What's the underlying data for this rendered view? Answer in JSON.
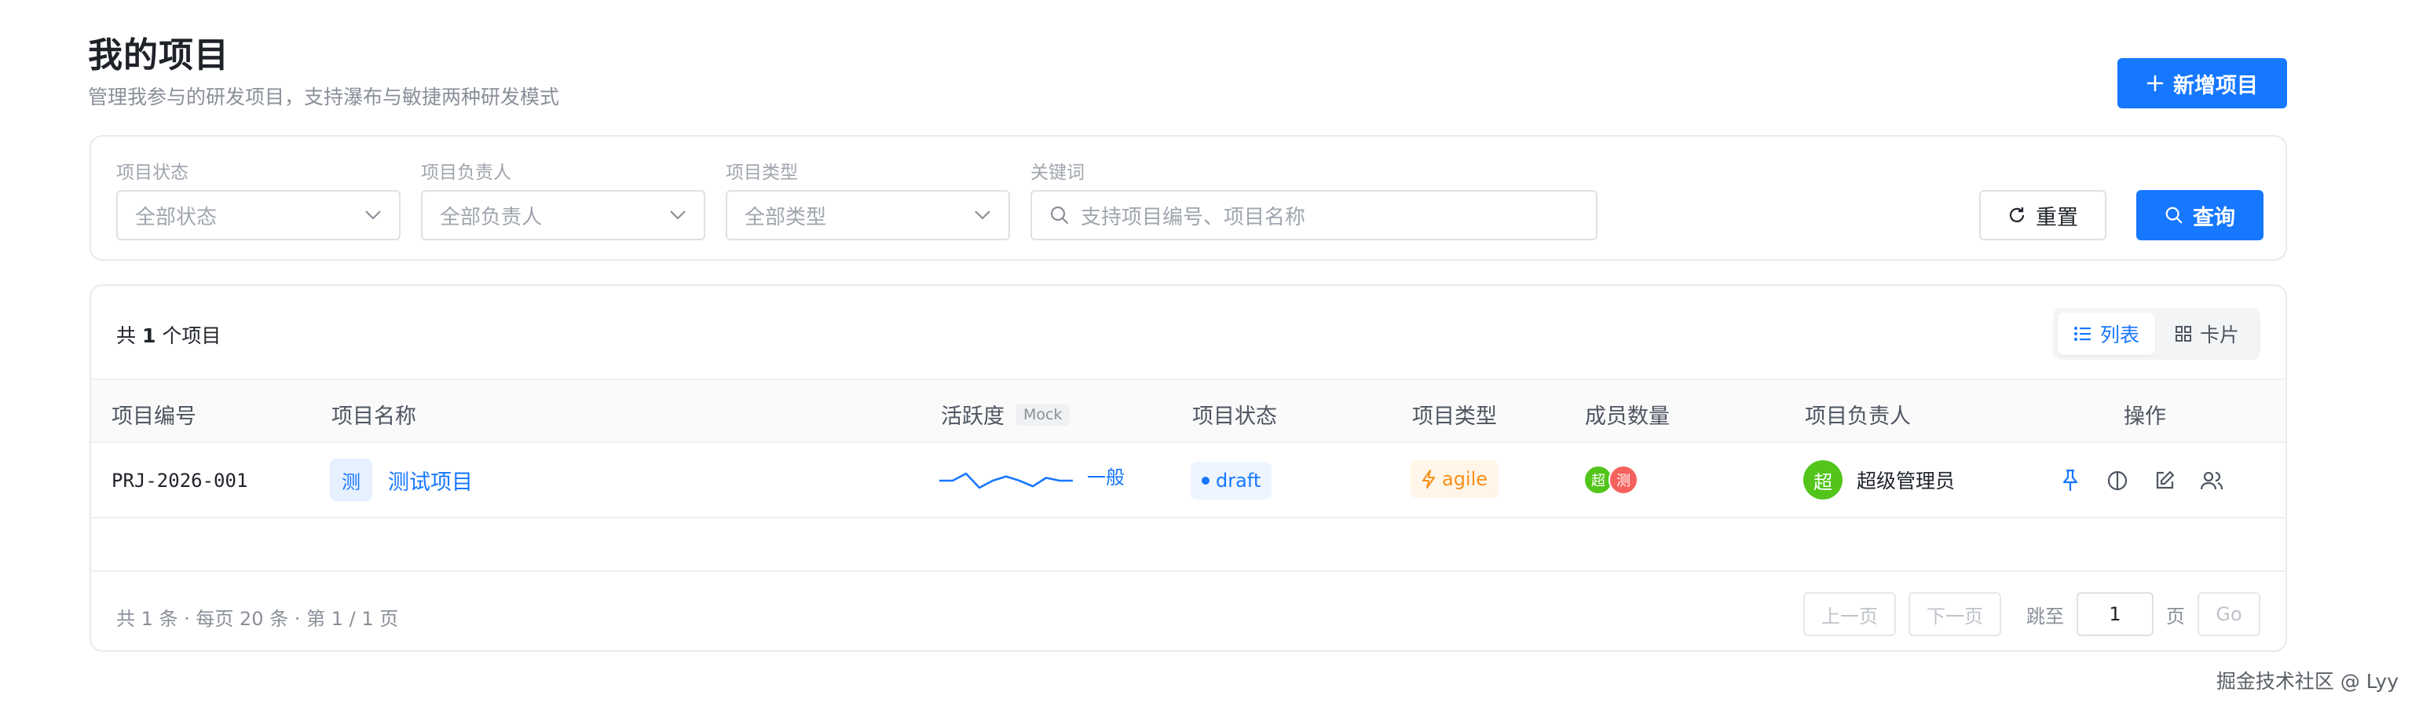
{
  "header": {
    "title": "我的项目",
    "subtitle": "管理我参与的研发项目，支持瀑布与敏捷两种研发模式",
    "add_button": "新增项目"
  },
  "filters": {
    "status": {
      "label": "项目状态",
      "placeholder": "全部状态"
    },
    "owner": {
      "label": "项目负责人",
      "placeholder": "全部负责人"
    },
    "type": {
      "label": "项目类型",
      "placeholder": "全部类型"
    },
    "keyword": {
      "label": "关键词",
      "placeholder": "支持项目编号、项目名称"
    },
    "reset_button": "重置",
    "query_button": "查询"
  },
  "summary": {
    "prefix": "共",
    "count": "1",
    "suffix": "个项目"
  },
  "view_toggle": {
    "list": "列表",
    "card": "卡片",
    "active": "list"
  },
  "table": {
    "columns": [
      "项目编号",
      "项目名称",
      "活跃度",
      "项目状态",
      "项目类型",
      "成员数量",
      "项目负责人",
      "操作"
    ],
    "activity_badge": "Mock",
    "rows": [
      {
        "code": "PRJ-2026-001",
        "avatar": "测",
        "name": "测试项目",
        "activity": "一般",
        "activity_trend": [
          0,
          0,
          1,
          -1,
          0,
          0.6,
          0,
          -0.8,
          0.4,
          0,
          0
        ],
        "status": "draft",
        "type": "agile",
        "members": [
          {
            "initial": "超",
            "color": "#52c41a"
          },
          {
            "initial": "测",
            "color": "#f5615c"
          }
        ],
        "owner_initial": "超",
        "owner_name": "超级管理员"
      }
    ]
  },
  "pagination": {
    "info": "共 1 条 · 每页 20 条 · 第 1 / 1 页",
    "prev": "上一页",
    "next": "下一页",
    "jump_label": "跳至",
    "page_value": "1",
    "page_suffix": "页",
    "go": "Go"
  },
  "watermark": "掘金技术社区 @ Lyy",
  "colors": {
    "primary": "#1677ff",
    "agile": "#f5901a",
    "owner": "#52c41a"
  }
}
